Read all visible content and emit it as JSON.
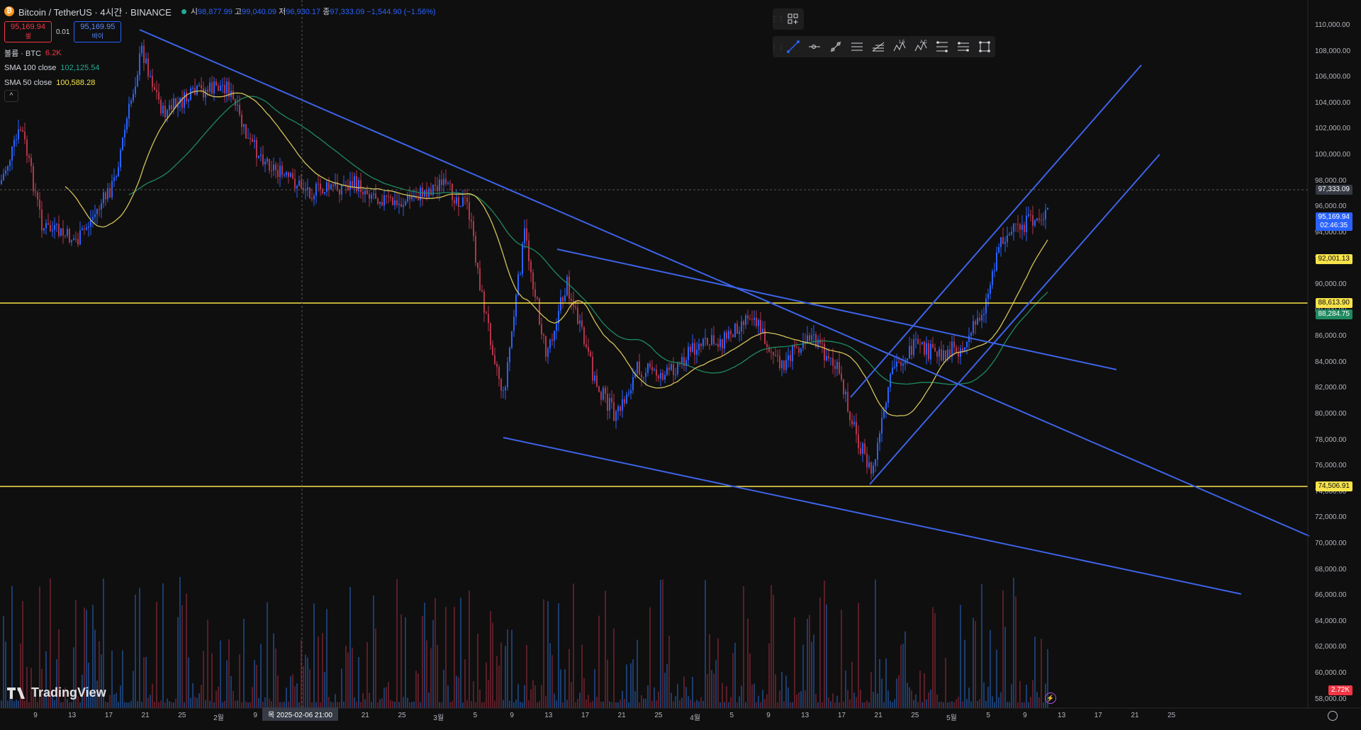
{
  "header": {
    "title": "Bitcoin / TetherUS · 4시간 · BINANCE",
    "open_label": "시",
    "open": "98,877.99",
    "high_label": "고",
    "high": "99,040.09",
    "low_label": "저",
    "low": "96,930.17",
    "close_label": "종",
    "close": "97,333.09",
    "change": "−1,544.90 (−1.56%)"
  },
  "quote": {
    "sell_price": "95,169.94",
    "sell_label": "셀",
    "spread": "0.01",
    "buy_price": "95,169.95",
    "buy_label": "바이"
  },
  "indicators": {
    "volume_label": "볼륨 · BTC",
    "volume_value": "6.2K",
    "sma100_label": "SMA 100 close",
    "sma100_value": "102,125.54",
    "sma50_label": "SMA 50 close",
    "sma50_value": "100,588.28",
    "collapse_glyph": "^"
  },
  "toolbar": {
    "group1": [
      "layout-add-icon"
    ],
    "group2": [
      "trend-line-icon",
      "horizontal-ray-icon",
      "info-line-icon",
      "parallel-channel-icon",
      "pitchfork-icon",
      "elliott-wave-icon",
      "abcd-pattern-icon",
      "fib-retracement-icon",
      "fib-extension-icon",
      "rectangle-icon"
    ],
    "labels_wave": "1 5",
    "labels_abcd": "A C"
  },
  "price_axis": {
    "ticks": [
      "110,000.00",
      "108,000.00",
      "106,000.00",
      "104,000.00",
      "102,000.00",
      "100,000.00",
      "98,000.00",
      "96,000.00",
      "94,000.00",
      "92,000.00",
      "90,000.00",
      "88,000.00",
      "86,000.00",
      "84,000.00",
      "82,000.00",
      "80,000.00",
      "78,000.00",
      "76,000.00",
      "74,000.00",
      "72,000.00",
      "70,000.00",
      "68,000.00",
      "66,000.00",
      "64,000.00",
      "62,000.00",
      "60,000.00",
      "58,000.00"
    ],
    "tags": {
      "crosshair_price": "97,333.09",
      "last_price": "95,169.94",
      "countdown": "02:46:35",
      "level_yellow_mid": "92,001.13",
      "level_yellow_upper": "88,613.90",
      "sma_green": "88,284.75",
      "level_yellow_lower": "74,506.91",
      "volume_tag": "2.72K"
    }
  },
  "time_axis": {
    "labels": [
      "9",
      "13",
      "17",
      "21",
      "25",
      "2월",
      "9",
      "13",
      "17",
      "21",
      "25",
      "3월",
      "5",
      "9",
      "13",
      "17",
      "21",
      "25",
      "4월",
      "5",
      "9",
      "13",
      "17",
      "21",
      "25",
      "5월",
      "5",
      "9",
      "13",
      "17",
      "21",
      "25"
    ],
    "crosshair_label": "목 2025-02-06  21:00"
  },
  "branding": {
    "logo_text": "TradingView"
  },
  "colors": {
    "background": "#0f0f0f",
    "candle_up": "#2962ff",
    "candle_down": "#b2354a",
    "trendline": "#3d63e8",
    "horizontal_level": "#f7e34a",
    "sma50": "#d4c15a",
    "sma100": "#1f8a5f"
  }
}
